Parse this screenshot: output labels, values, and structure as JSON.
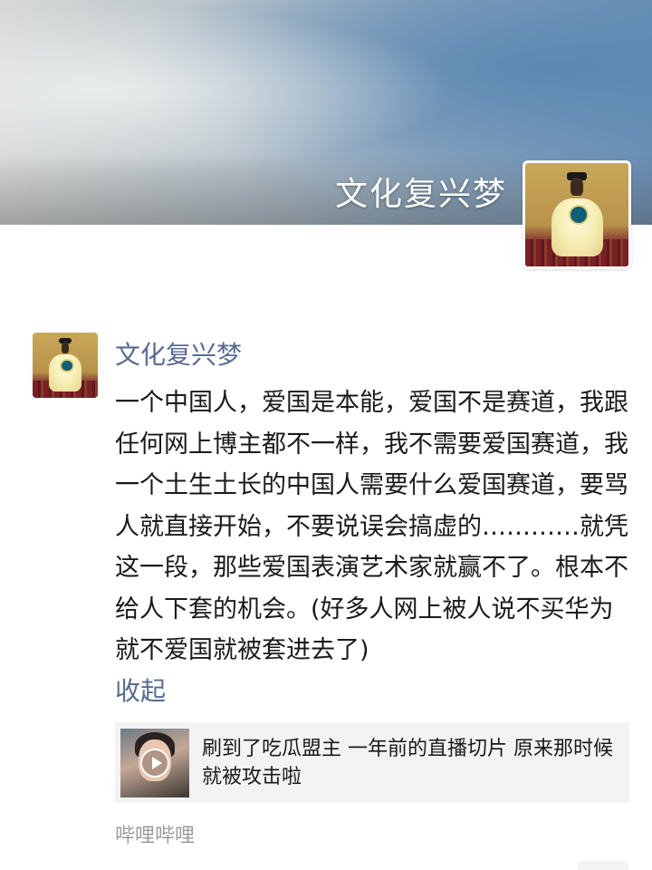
{
  "cover": {
    "username": "文化复兴梦"
  },
  "post": {
    "author": "文化复兴梦",
    "body": "一个中国人，爱国是本能，爱国不是赛道，我跟任何网上博主都不一样，我不需要爱国赛道，我一个土生土长的中国人需要什么爱国赛道，要骂人就直接开始，不要说误会搞虚的…………就凭这一段，那些爱国表演艺术家就赢不了。根本不给人下套的机会。(好多人网上被人说不买华为就不爱国就被套进去了)",
    "collapse_label": "收起",
    "share": {
      "title": "刷到了吃瓜盟主 一年前的直播切片 原来那时候 就被攻击啦",
      "thumb_icon": "video-play-icon"
    },
    "source": "哔哩哔哩"
  },
  "colors": {
    "link": "#576b95",
    "text": "#1a1a1a",
    "muted": "#9b9b9b",
    "card_bg": "#f3f3f5"
  }
}
